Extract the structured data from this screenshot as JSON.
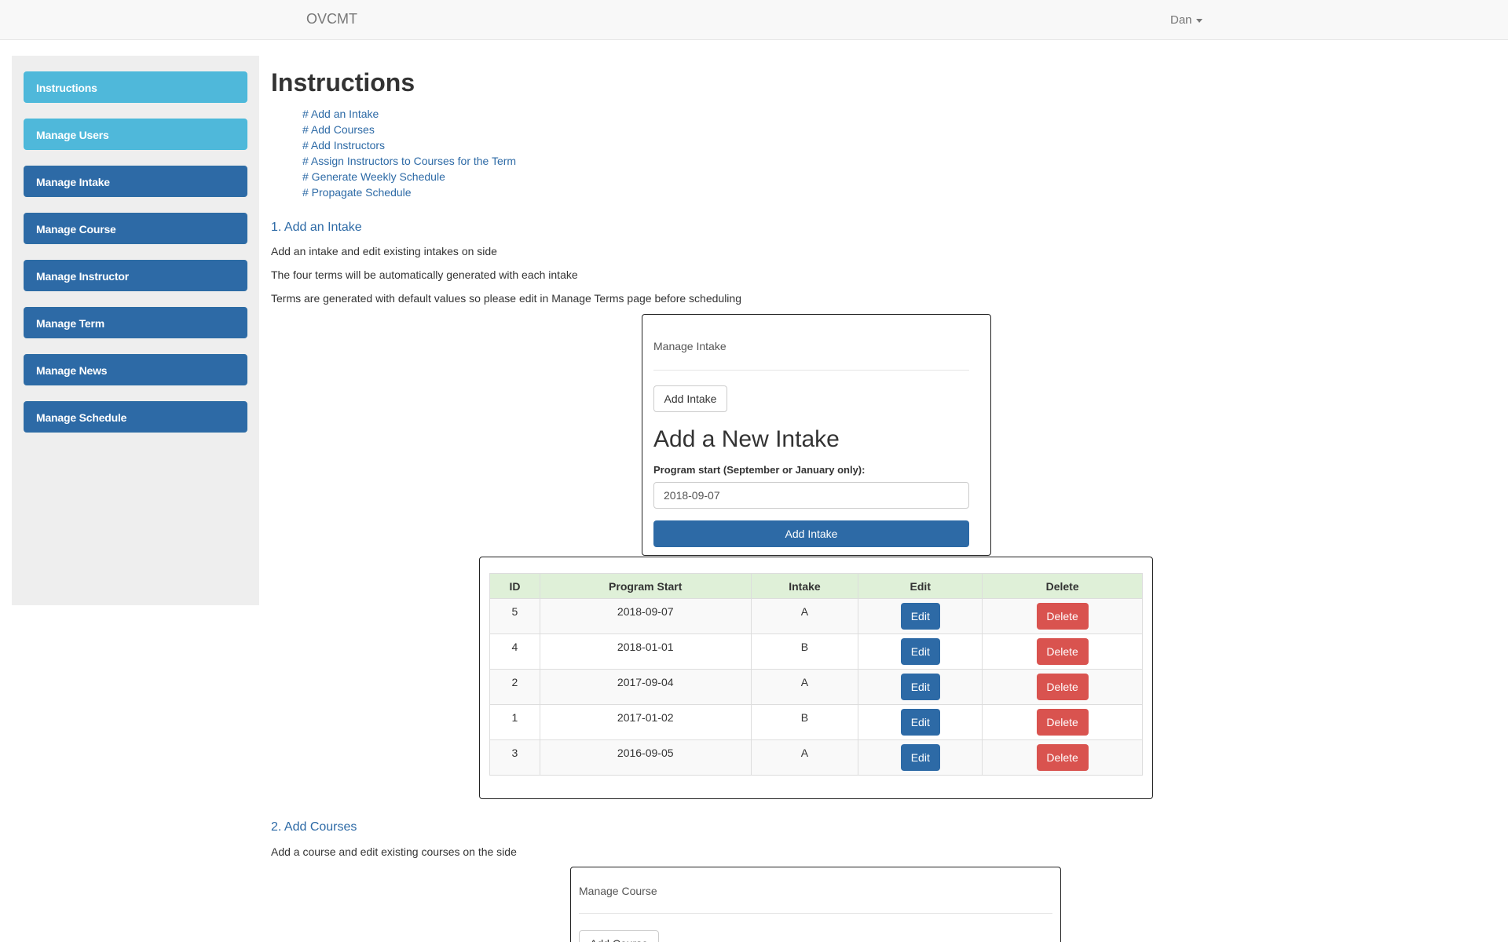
{
  "navbar": {
    "brand": "OVCMT",
    "user": "Dan"
  },
  "sidebar": {
    "items": [
      {
        "label": "Instructions"
      },
      {
        "label": "Manage Users"
      },
      {
        "label": "Manage Intake"
      },
      {
        "label": "Manage Course"
      },
      {
        "label": "Manage Instructor"
      },
      {
        "label": "Manage Term"
      },
      {
        "label": "Manage News"
      },
      {
        "label": "Manage Schedule"
      }
    ]
  },
  "main": {
    "title": "Instructions",
    "toc": [
      "# Add an Intake",
      "# Add Courses",
      "# Add Instructors",
      "# Assign Instructors to Courses for the Term",
      "# Generate Weekly Schedule",
      "# Propagate Schedule"
    ],
    "section1": {
      "title": "1. Add an Intake",
      "paragraphs": [
        "Add an intake and edit existing intakes on side",
        "The four terms will be automatically generated with each intake",
        "Terms are generated with default values so please edit in Manage Terms page before scheduling"
      ],
      "panel": {
        "heading": "Manage Intake",
        "add_button": "Add Intake",
        "form_title": "Add a New Intake",
        "label": "Program start (September or January only):",
        "input_value": "2018-09-07",
        "submit": "Add Intake"
      },
      "table": {
        "headers": [
          "ID",
          "Program Start",
          "Intake",
          "Edit",
          "Delete"
        ],
        "edit_label": "Edit",
        "delete_label": "Delete",
        "rows": [
          {
            "id": "5",
            "start": "2018-09-07",
            "intake": "A"
          },
          {
            "id": "4",
            "start": "2018-01-01",
            "intake": "B"
          },
          {
            "id": "2",
            "start": "2017-09-04",
            "intake": "A"
          },
          {
            "id": "1",
            "start": "2017-01-02",
            "intake": "B"
          },
          {
            "id": "3",
            "start": "2016-09-05",
            "intake": "A"
          }
        ]
      }
    },
    "section2": {
      "title": "2. Add Courses",
      "paragraph": "Add a course and edit existing courses on the side",
      "panel": {
        "heading": "Manage Course",
        "add_button": "Add Course"
      }
    }
  }
}
